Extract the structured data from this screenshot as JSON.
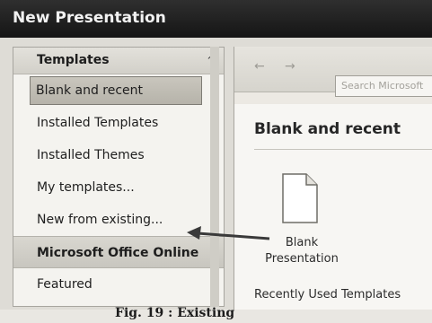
{
  "window": {
    "title": "New Presentation"
  },
  "sidebar": {
    "header": "Templates",
    "items": [
      {
        "label": "Blank and recent",
        "state": "selected"
      },
      {
        "label": "Installed Templates",
        "state": "normal"
      },
      {
        "label": "Installed Themes",
        "state": "normal"
      },
      {
        "label": "My templates...",
        "state": "normal"
      },
      {
        "label": "New from existing...",
        "state": "normal"
      },
      {
        "label": "Microsoft Office Online",
        "state": "group"
      },
      {
        "label": "Featured",
        "state": "normal"
      }
    ]
  },
  "toolbar": {
    "back_icon": "back-arrow-icon",
    "forward_icon": "forward-arrow-icon",
    "search_placeholder": "Search Microsoft"
  },
  "main": {
    "heading": "Blank and recent",
    "blank_item_line1": "Blank",
    "blank_item_line2": "Presentation",
    "recent_heading": "Recently Used Templates"
  },
  "caption": "Fig. 19 : Existing"
}
